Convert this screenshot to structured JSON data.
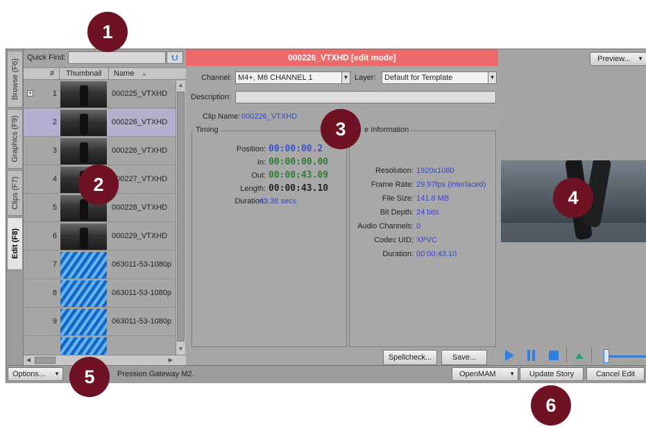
{
  "vertical_tabs": [
    {
      "label": "Browse (F6)"
    },
    {
      "label": "Graphics (F9)"
    },
    {
      "label": "Clips (F7)"
    },
    {
      "label": "Edit (F8)"
    }
  ],
  "quick_find": {
    "label": "Quick Find:",
    "value": ""
  },
  "grid": {
    "columns": [
      "#",
      "Thumbnail",
      "Name"
    ],
    "rows": [
      {
        "num": "1",
        "name": "000225_VTXHD",
        "thumb": "dark-clip",
        "expandable": true
      },
      {
        "num": "2",
        "name": "000226_VTXHD",
        "thumb": "dark-clip",
        "selected": true
      },
      {
        "num": "3",
        "name": "000226_VTXHD",
        "thumb": "dark-clip"
      },
      {
        "num": "4",
        "name": "000227_VTXHD",
        "thumb": "dark-clip"
      },
      {
        "num": "5",
        "name": "000228_VTXHD",
        "thumb": "dark-clip"
      },
      {
        "num": "6",
        "name": "000229_VTXHD",
        "thumb": "dark-clip"
      },
      {
        "num": "7",
        "name": "063011-53-1080p",
        "thumb": "blue-streaks"
      },
      {
        "num": "8",
        "name": "063011-53-1080p",
        "thumb": "blue-streaks"
      },
      {
        "num": "9",
        "name": "063011-53-1080p",
        "thumb": "blue-streaks"
      },
      {
        "num": "",
        "name": "",
        "thumb": "blue-streaks"
      }
    ]
  },
  "editor": {
    "title": "000226_VTXHD [edit mode]",
    "channel_label": "Channel:",
    "channel_value": "M4+, M6 CHANNEL 1",
    "layer_label": "Layer:",
    "layer_value": "Default for Template",
    "description_label": "Description:",
    "description_value": "",
    "clip_name_label": "Clip Name:",
    "clip_name_value": "000226_VTXHD",
    "timing": {
      "title": "Timing",
      "position_label": "Position:",
      "position_value": "00:00:00.2",
      "in_label": "In:",
      "in_value": "00:00:00.00",
      "out_label": "Out:",
      "out_value": "00:00:43.09",
      "length_label": "Length:",
      "length_value": "00:00:43.10",
      "duration_label": "Duration:",
      "duration_value": "43.38 secs"
    },
    "file_info": {
      "title": "e Information",
      "resolution_label": "Resolution:",
      "resolution_value": "1920x1080",
      "frame_rate_label": "Frame Rate:",
      "frame_rate_value": "29.97fps (interlaced)",
      "file_size_label": "File Size:",
      "file_size_value": "141.8 MB",
      "bit_depth_label": "Bit Depth:",
      "bit_depth_value": "24 bits",
      "audio_channels_label": "Audio Channels:",
      "audio_channels_value": "0",
      "codec_label": "Codec UID:",
      "codec_value": "XPVC",
      "duration_label": "Duration:",
      "duration_value": "00:00:43.10"
    },
    "spellcheck_label": "Spellcheck...",
    "save_label": "Save..."
  },
  "preview": {
    "dropdown_label": "Preview..."
  },
  "status_bar": {
    "options_label": "Options...",
    "message": "Pression Gateway M2.",
    "openmam_label": "OpenMAM",
    "update_story_label": "Update Story",
    "cancel_edit_label": "Cancel Edit"
  },
  "callouts": [
    "1",
    "2",
    "3",
    "4",
    "5",
    "6"
  ],
  "colors": {
    "edit_title_bar": "#ec6a6a",
    "callout": "#6e1224",
    "value_blue": "#3546c8",
    "timecode_green": "#2e7d32",
    "timecode_blue": "#3a4fc8",
    "selected_row": "#b3b0d0"
  }
}
